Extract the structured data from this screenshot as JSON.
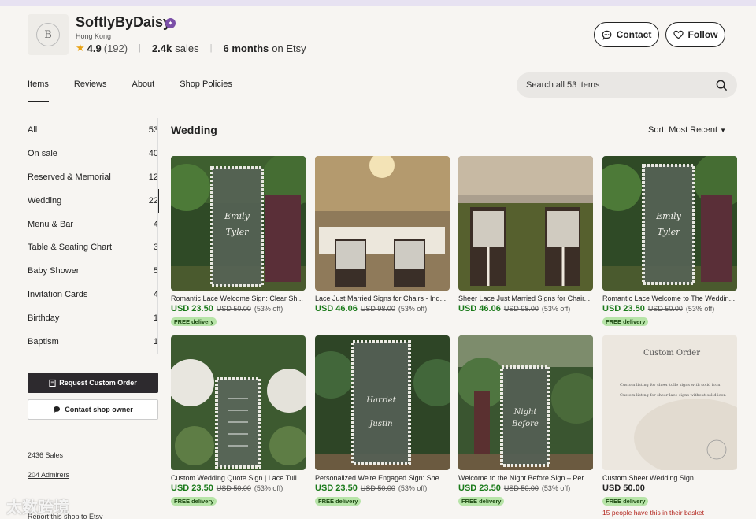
{
  "shop": {
    "name": "SoftlyByDaisy",
    "logo_initials": "B",
    "location": "Hong Kong",
    "rating": "4.9",
    "rating_count": "(192)",
    "sales_value": "2.4k",
    "sales_label": "sales",
    "age_value": "6 months",
    "age_label": "on Etsy",
    "contact_label": "Contact",
    "follow_label": "Follow"
  },
  "tabs": [
    {
      "label": "Items",
      "active": true
    },
    {
      "label": "Reviews"
    },
    {
      "label": "About"
    },
    {
      "label": "Shop Policies"
    }
  ],
  "search": {
    "placeholder": "Search all 53 items"
  },
  "sidebar": {
    "categories": [
      {
        "label": "All",
        "count": "53"
      },
      {
        "label": "On sale",
        "count": "40"
      },
      {
        "label": "Reserved & Memorial",
        "count": "12"
      },
      {
        "label": "Wedding",
        "count": "22",
        "active": true
      },
      {
        "label": "Menu & Bar",
        "count": "4"
      },
      {
        "label": "Table & Seating Chart",
        "count": "3"
      },
      {
        "label": "Baby Shower",
        "count": "5"
      },
      {
        "label": "Invitation Cards",
        "count": "4"
      },
      {
        "label": "Birthday",
        "count": "1"
      },
      {
        "label": "Baptism",
        "count": "1"
      }
    ],
    "request_custom_order": "Request Custom Order",
    "contact_owner": "Contact shop owner",
    "sales_text": "2436 Sales",
    "admirers_text": "204 Admirers",
    "report_text": "Report this shop to Etsy"
  },
  "main": {
    "section_title": "Wedding",
    "sort_label": "Sort: Most Recent"
  },
  "listings": [
    {
      "title": "Romantic Lace Welcome Sign: Clear Sh...",
      "price": "USD 23.50",
      "original": "USD 50.00",
      "discount": "(53% off)",
      "badge": "FREE delivery",
      "image": "lace-sign-garden"
    },
    {
      "title": "Lace Just Married Signs for Chairs - Ind...",
      "price": "USD 46.06",
      "original": "USD 98.00",
      "discount": "(53% off)",
      "badge": "",
      "image": "chair-signs-ballroom"
    },
    {
      "title": "Sheer Lace Just Married Signs for Chair...",
      "price": "USD 46.06",
      "original": "USD 98.00",
      "discount": "(53% off)",
      "badge": "",
      "image": "chair-signs-green"
    },
    {
      "title": "Romantic Lace Welcome to The Weddin...",
      "price": "USD 23.50",
      "original": "USD 50.00",
      "discount": "(53% off)",
      "badge": "FREE delivery",
      "image": "lace-sign-garden"
    },
    {
      "title": "Custom Wedding Quote Sign | Lace Tull...",
      "price": "USD 23.50",
      "original": "USD 50.00",
      "discount": "(53% off)",
      "badge": "FREE delivery",
      "image": "quote-sign-flowers"
    },
    {
      "title": "Personalized We're Engaged Sign: Sheer...",
      "price": "USD 23.50",
      "original": "USD 50.00",
      "discount": "(53% off)",
      "badge": "FREE delivery",
      "image": "engaged-sign"
    },
    {
      "title": "Welcome to the Night Before Sign – Per...",
      "price": "USD 23.50",
      "original": "USD 50.00",
      "discount": "(53% off)",
      "badge": "FREE delivery",
      "image": "night-before-sign"
    },
    {
      "title": "Custom Sheer Wedding Sign",
      "price": "USD 50.00",
      "original": "",
      "discount": "",
      "badge": "FREE delivery",
      "basket": "15 people have this in their basket",
      "image": "custom-order-card",
      "card_title": "Custom Order",
      "card_lines": [
        "Custom listing for sheer tulle signs with solid icon",
        "Custom listing for sheer lace signs without solid icon"
      ]
    }
  ],
  "watermark": "太数跨境",
  "colors": {
    "accent": "#222222",
    "price": "#1a7a1a",
    "badge_bg": "#b7e4a8",
    "star": "#e8a317",
    "alert": "#b3261e"
  }
}
